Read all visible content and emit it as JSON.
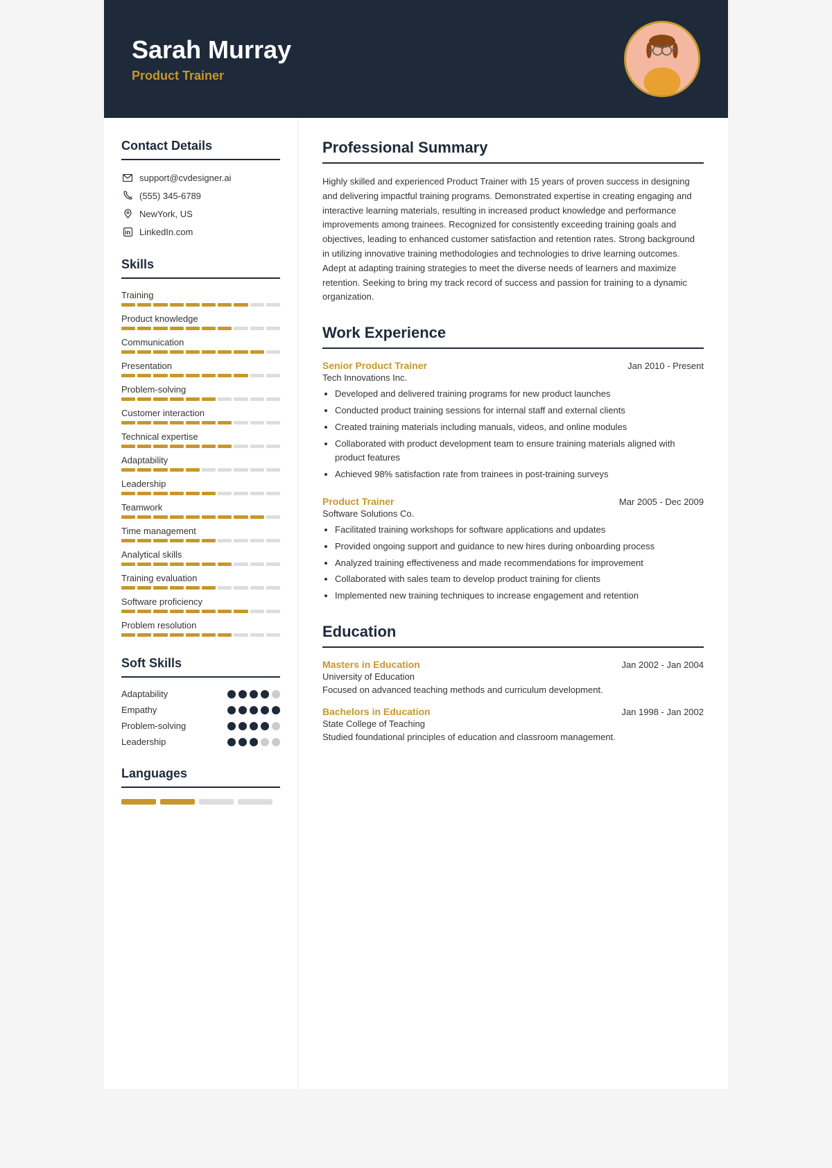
{
  "header": {
    "name": "Sarah Murray",
    "title": "Product Trainer"
  },
  "contact": {
    "section_title": "Contact Details",
    "items": [
      {
        "icon": "✉",
        "text": "support@cvdesigner.ai"
      },
      {
        "icon": "📞",
        "text": "(555) 345-6789"
      },
      {
        "icon": "🏠",
        "text": "NewYork, US"
      },
      {
        "icon": "in",
        "text": "LinkedIn.com"
      }
    ]
  },
  "skills": {
    "section_title": "Skills",
    "items": [
      {
        "name": "Training",
        "filled": 8,
        "total": 10
      },
      {
        "name": "Product knowledge",
        "filled": 7,
        "total": 10
      },
      {
        "name": "Communication",
        "filled": 9,
        "total": 10
      },
      {
        "name": "Presentation",
        "filled": 8,
        "total": 10
      },
      {
        "name": "Problem-solving",
        "filled": 6,
        "total": 10
      },
      {
        "name": "Customer interaction",
        "filled": 7,
        "total": 10
      },
      {
        "name": "Technical expertise",
        "filled": 7,
        "total": 10
      },
      {
        "name": "Adaptability",
        "filled": 5,
        "total": 10
      },
      {
        "name": "Leadership",
        "filled": 6,
        "total": 10
      },
      {
        "name": "Teamwork",
        "filled": 9,
        "total": 10
      },
      {
        "name": "Time management",
        "filled": 6,
        "total": 10
      },
      {
        "name": "Analytical skills",
        "filled": 7,
        "total": 10
      },
      {
        "name": "Training evaluation",
        "filled": 6,
        "total": 10
      },
      {
        "name": "Software proficiency",
        "filled": 8,
        "total": 10
      },
      {
        "name": "Problem resolution",
        "filled": 7,
        "total": 10
      }
    ]
  },
  "soft_skills": {
    "section_title": "Soft Skills",
    "items": [
      {
        "name": "Adaptability",
        "filled": 4,
        "total": 5
      },
      {
        "name": "Empathy",
        "filled": 5,
        "total": 5
      },
      {
        "name": "Problem-solving",
        "filled": 4,
        "total": 5
      },
      {
        "name": "Leadership",
        "filled": 3,
        "total": 5
      }
    ]
  },
  "languages": {
    "section_title": "Languages"
  },
  "summary": {
    "section_title": "Professional Summary",
    "text": "Highly skilled and experienced Product Trainer with 15 years of proven success in designing and delivering impactful training programs. Demonstrated expertise in creating engaging and interactive learning materials, resulting in increased product knowledge and performance improvements among trainees. Recognized for consistently exceeding training goals and objectives, leading to enhanced customer satisfaction and retention rates. Strong background in utilizing innovative training methodologies and technologies to drive learning outcomes. Adept at adapting training strategies to meet the diverse needs of learners and maximize retention. Seeking to bring my track record of success and passion for training to a dynamic organization."
  },
  "work_experience": {
    "section_title": "Work Experience",
    "jobs": [
      {
        "title": "Senior Product Trainer",
        "dates": "Jan 2010 - Present",
        "company": "Tech Innovations Inc.",
        "bullets": [
          "Developed and delivered training programs for new product launches",
          "Conducted product training sessions for internal staff and external clients",
          "Created training materials including manuals, videos, and online modules",
          "Collaborated with product development team to ensure training materials aligned with product features",
          "Achieved 98% satisfaction rate from trainees in post-training surveys"
        ]
      },
      {
        "title": "Product Trainer",
        "dates": "Mar 2005 - Dec 2009",
        "company": "Software Solutions Co.",
        "bullets": [
          "Facilitated training workshops for software applications and updates",
          "Provided ongoing support and guidance to new hires during onboarding process",
          "Analyzed training effectiveness and made recommendations for improvement",
          "Collaborated with sales team to develop product training for clients",
          "Implemented new training techniques to increase engagement and retention"
        ]
      }
    ]
  },
  "education": {
    "section_title": "Education",
    "entries": [
      {
        "degree": "Masters in Education",
        "dates": "Jan 2002 - Jan 2004",
        "school": "University of Education",
        "description": "Focused on advanced teaching methods and curriculum development."
      },
      {
        "degree": "Bachelors in Education",
        "dates": "Jan 1998 - Jan 2002",
        "school": "State College of Teaching",
        "description": "Studied foundational principles of education and classroom management."
      }
    ]
  }
}
